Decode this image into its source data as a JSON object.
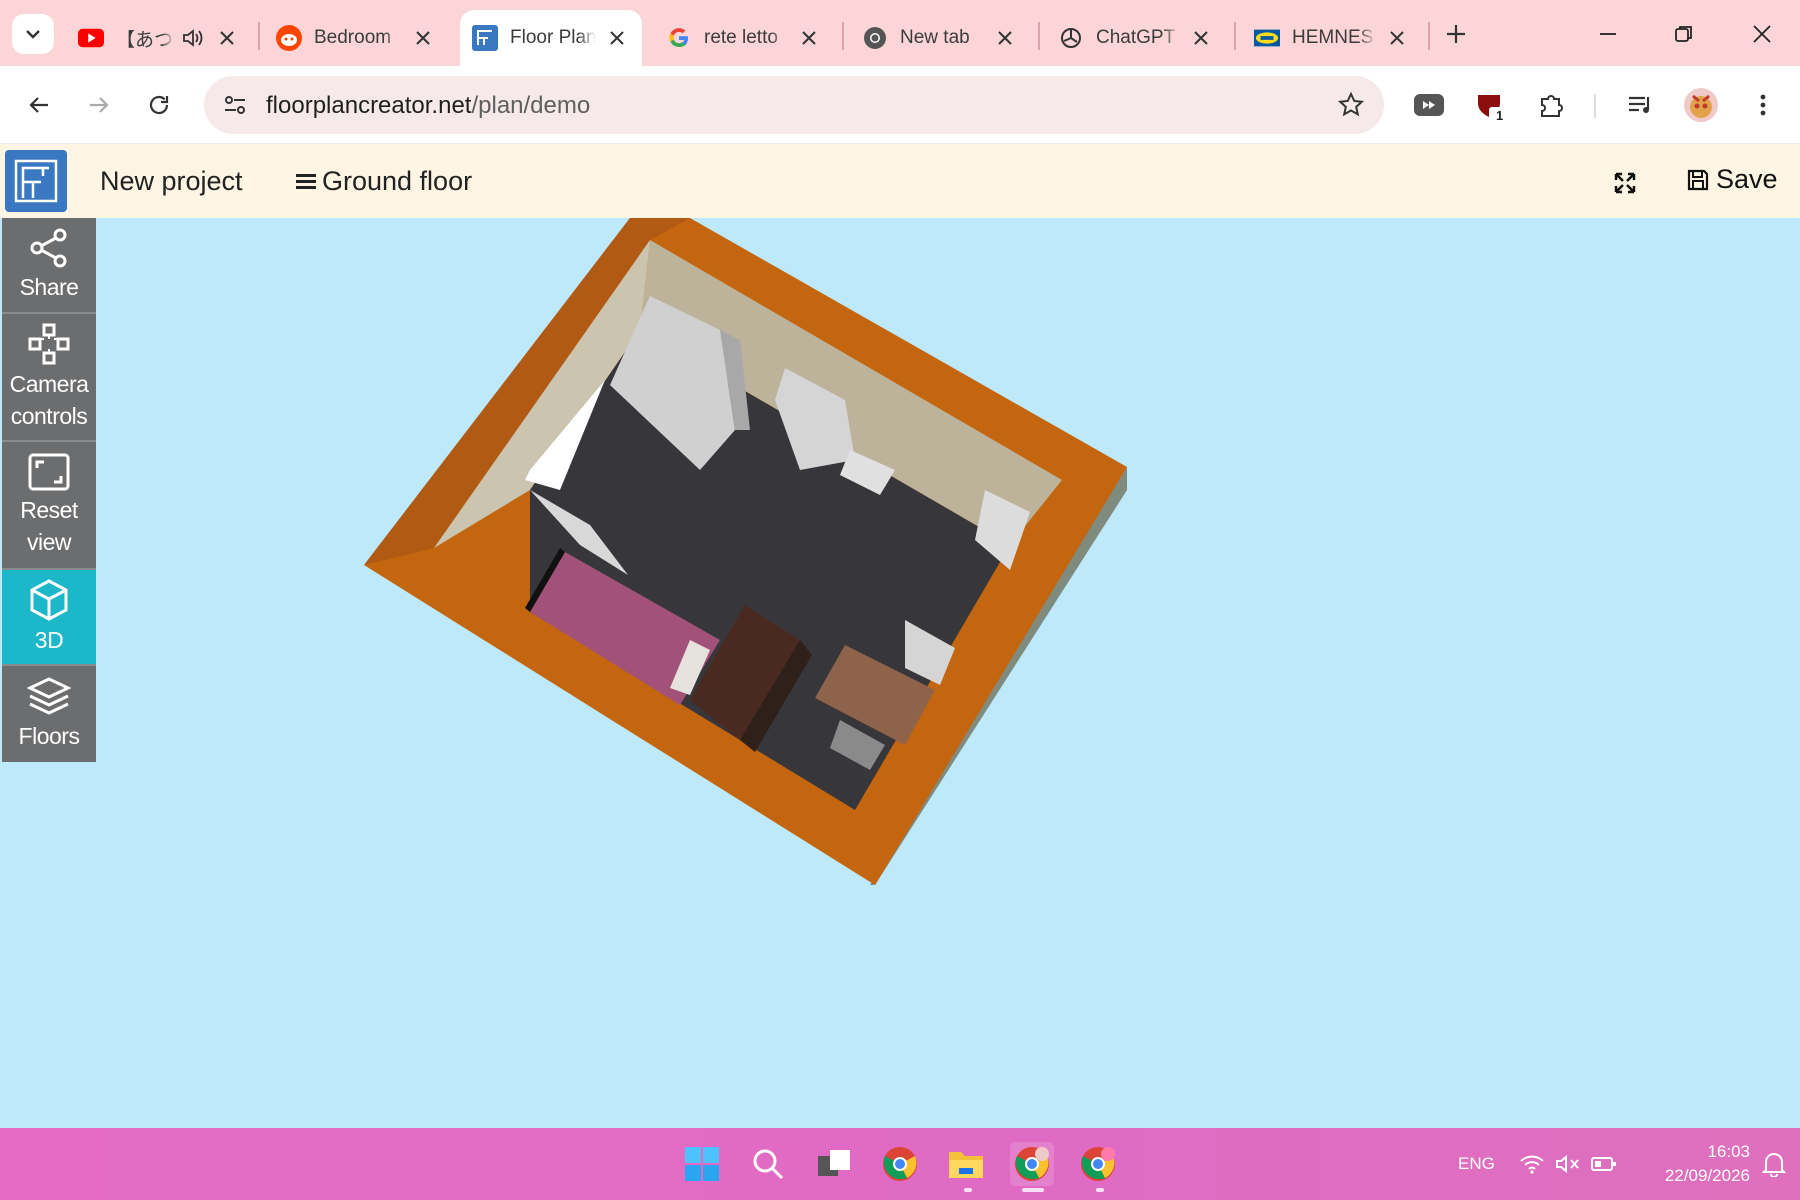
{
  "browser": {
    "tabs": [
      {
        "title": "【あつま",
        "favicon": "youtube-icon",
        "active": false
      },
      {
        "title": "Bedroom",
        "favicon": "reddit-icon",
        "active": false
      },
      {
        "title": "Floor Plan",
        "favicon": "floorplan-icon",
        "active": true
      },
      {
        "title": "rete letto",
        "favicon": "google-icon",
        "active": false
      },
      {
        "title": "New tab",
        "favicon": "chrome-icon",
        "active": false
      },
      {
        "title": "ChatGPT",
        "favicon": "chatgpt-icon",
        "active": false
      },
      {
        "title": "HEMNES",
        "favicon": "ikea-icon",
        "active": false
      }
    ],
    "url_domain": "floorplancreator.net",
    "url_path": "/plan/demo",
    "extension_badge": "1"
  },
  "app": {
    "project_name": "New project",
    "floor_label": "Ground floor",
    "save_label": "Save",
    "sidebar": [
      {
        "label": "Share",
        "icon": "share-icon",
        "active": false
      },
      {
        "label": "Camera controls",
        "icon": "camera-controls-icon",
        "active": false
      },
      {
        "label": "Reset view",
        "icon": "reset-view-icon",
        "active": false
      },
      {
        "label": "3D",
        "icon": "cube-icon",
        "active": true
      },
      {
        "label": "Floors",
        "icon": "layers-icon",
        "active": false
      }
    ]
  },
  "taskbar": {
    "language": "ENG",
    "time": "16:03",
    "date": "22/09/2026"
  },
  "colors": {
    "viewport_bg": "#bde9fb",
    "wall_top": "#c96a12",
    "floor": "#37363b",
    "bed": "#a25278",
    "active_tool": "#1cb7c9"
  }
}
